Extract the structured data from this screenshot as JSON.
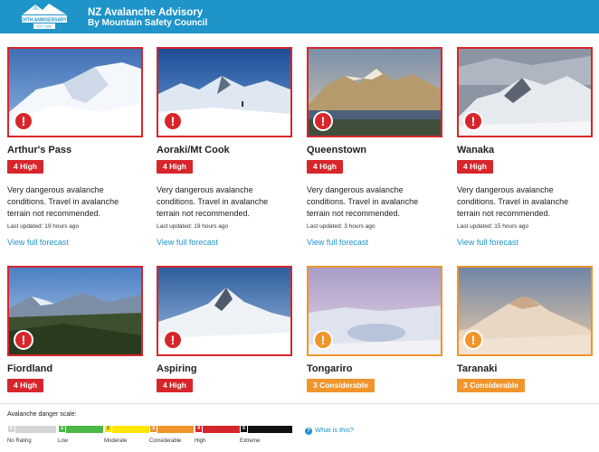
{
  "header": {
    "logo_text_top": "20TH ANNIVERSARY",
    "logo_text_bottom": "EST 2000",
    "brand_line1": "NZ Avalanche Advisory",
    "brand_line2": "By Mountain Safety Council",
    "background": "#1e94c8"
  },
  "regions": [
    {
      "name": "Arthur's Pass",
      "level": "4 High",
      "color": "#d7262b",
      "description": "Very dangerous avalanche conditions. Travel in avalanche terrain not recommended.",
      "updated": "Last updated: 19 hours ago",
      "link": "View full forecast"
    },
    {
      "name": "Aoraki/Mt Cook",
      "level": "4 High",
      "color": "#d7262b",
      "description": "Very dangerous avalanche conditions. Travel in avalanche terrain not recommended.",
      "updated": "Last updated: 19 hours ago",
      "link": "View full forecast"
    },
    {
      "name": "Queenstown",
      "level": "4 High",
      "color": "#d7262b",
      "description": "Very dangerous avalanche conditions. Travel in avalanche terrain not recommended.",
      "updated": "Last updated: 3 hours ago",
      "link": "View full forecast"
    },
    {
      "name": "Wanaka",
      "level": "4 High",
      "color": "#d7262b",
      "description": "Very dangerous avalanche conditions. Travel in avalanche terrain not recommended.",
      "updated": "Last updated: 15 hours ago",
      "link": "View full forecast"
    },
    {
      "name": "Fiordland",
      "level": "4 High",
      "color": "#d7262b"
    },
    {
      "name": "Aspiring",
      "level": "4 High",
      "color": "#d7262b"
    },
    {
      "name": "Tongariro",
      "level": "3 Considerable",
      "color": "#f0952c"
    },
    {
      "name": "Taranaki",
      "level": "3 Considerable",
      "color": "#f0952c"
    }
  ],
  "scale": {
    "title": "Avalanche danger scale:",
    "levels": [
      {
        "num": "0",
        "label": "No Rating",
        "color": "#d4d4d4"
      },
      {
        "num": "1",
        "label": "Low",
        "color": "#4cb848"
      },
      {
        "num": "2",
        "label": "Moderate",
        "color": "#ffe500"
      },
      {
        "num": "3",
        "label": "Considerable",
        "color": "#f0952c"
      },
      {
        "num": "4",
        "label": "High",
        "color": "#d7262b"
      },
      {
        "num": "5",
        "label": "Extreme",
        "color": "#111111"
      }
    ],
    "help_link": "What is this?"
  }
}
